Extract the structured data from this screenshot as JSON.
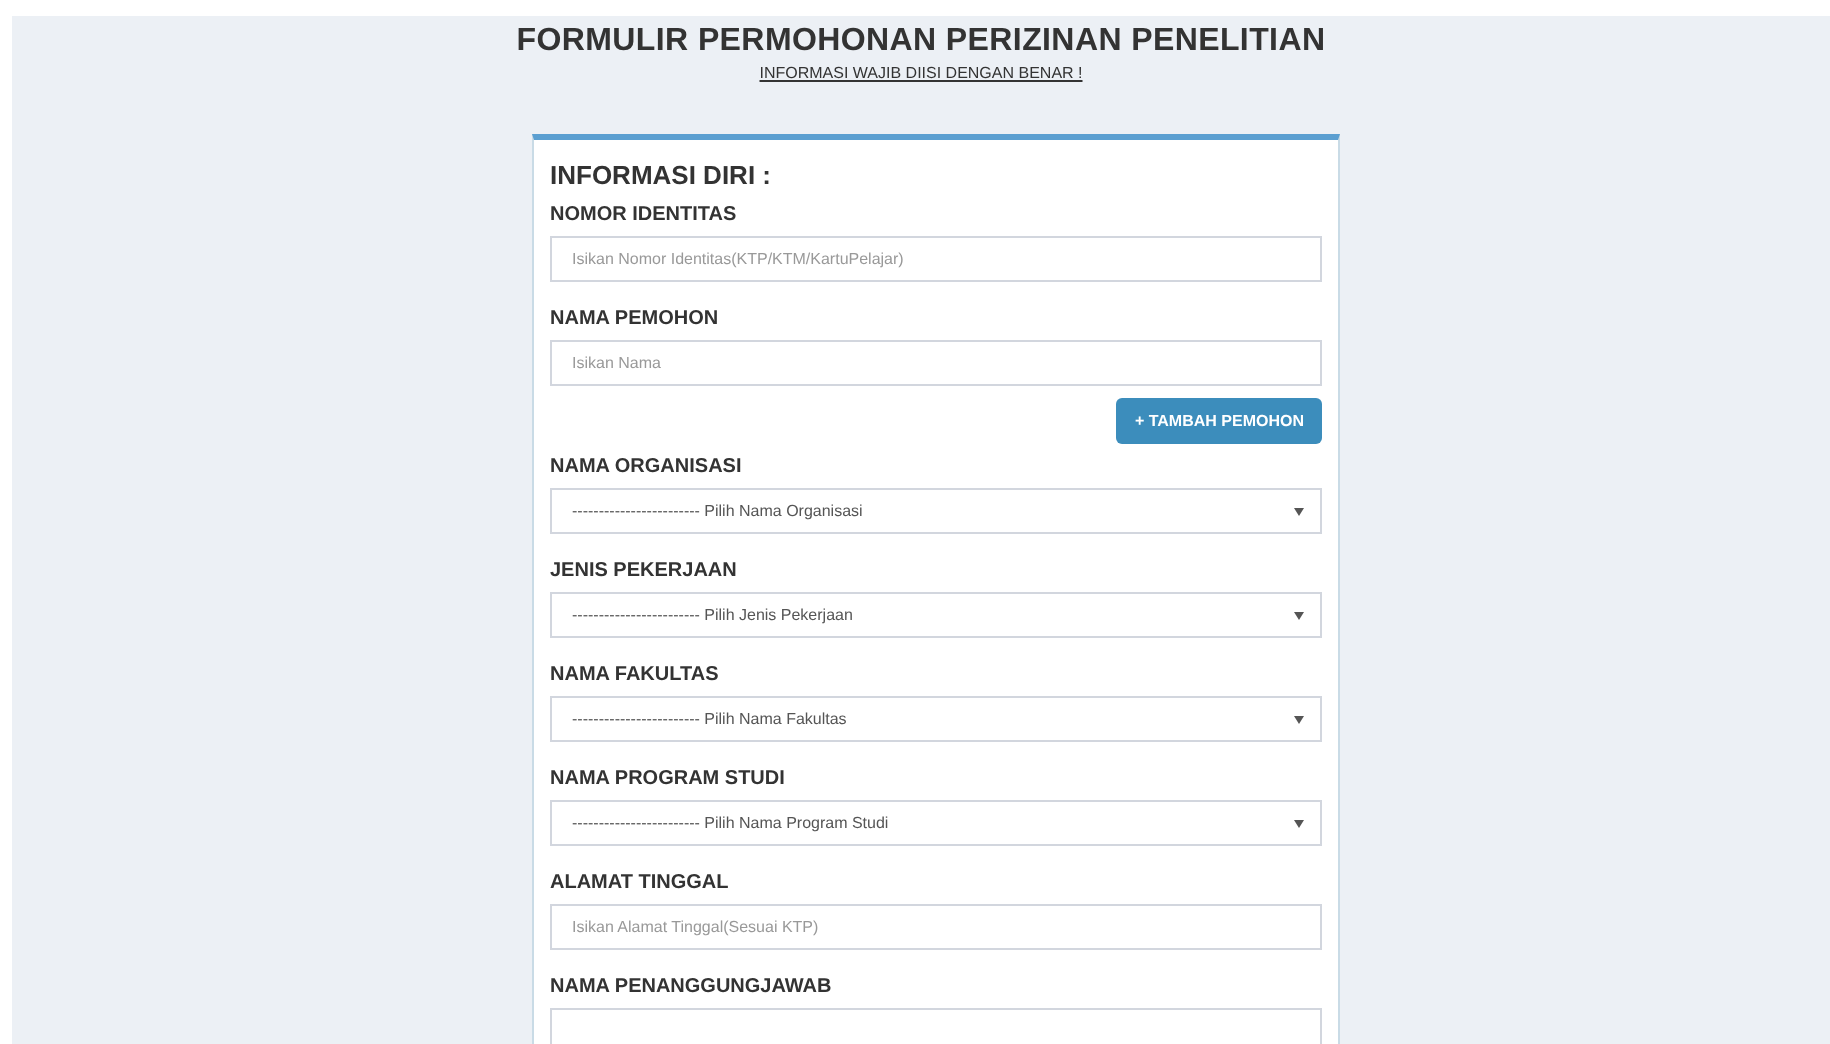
{
  "header": {
    "title": "FORMULIR PERMOHONAN PERIZINAN PENELITIAN",
    "subtitle": "INFORMASI WAJIB DIISI DENGAN BENAR !"
  },
  "card": {
    "title": "INFORMASI DIRI :",
    "items": [
      {
        "kind": "text",
        "label": "NOMOR IDENTITAS",
        "placeholder": "Isikan Nomor Identitas(KTP/KTM/KartuPelajar)"
      },
      {
        "kind": "text",
        "label": "NAMA PEMOHON",
        "placeholder": "Isikan Nama"
      },
      {
        "kind": "button",
        "label": "+ TAMBAH PEMOHON"
      },
      {
        "kind": "select",
        "label": "NAMA ORGANISASI",
        "value": "------------------------ Pilih Nama Organisasi"
      },
      {
        "kind": "select",
        "label": "JENIS PEKERJAAN",
        "value": "------------------------ Pilih Jenis Pekerjaan"
      },
      {
        "kind": "select",
        "label": "NAMA FAKULTAS",
        "value": "------------------------ Pilih Nama Fakultas"
      },
      {
        "kind": "select",
        "label": "NAMA PROGRAM STUDI",
        "value": "------------------------ Pilih Nama Program Studi"
      },
      {
        "kind": "text",
        "label": "ALAMAT TINGGAL",
        "placeholder": "Isikan Alamat Tinggal(Sesuai KTP)"
      },
      {
        "kind": "text",
        "label": "NAMA PENANGGUNGJAWAB"
      }
    ]
  }
}
